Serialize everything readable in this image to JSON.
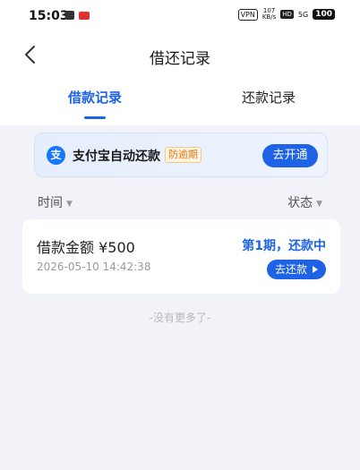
{
  "status_bar": {
    "time": "15:03",
    "vpn": "VPN",
    "net_speed_value": "107",
    "net_speed_unit": "KB/s",
    "hd": "HD",
    "signal": "5G",
    "battery": "100"
  },
  "header": {
    "title": "借还记录",
    "back_icon": "chevron-left-icon"
  },
  "tabs": [
    {
      "label": "借款记录",
      "active": true
    },
    {
      "label": "还款记录",
      "active": false
    }
  ],
  "alipay_banner": {
    "icon": "alipay-icon",
    "icon_glyph": "支",
    "text": "支付宝自动还款",
    "badge": "防逾期",
    "button_label": "去开通"
  },
  "filters": {
    "time_label": "时间",
    "status_label": "状态"
  },
  "records": [
    {
      "amount_label": "借款金额 ¥500",
      "datetime": "2026-05-10 14:42:38",
      "status": "第1期，还款中",
      "action_label": "去还款"
    }
  ],
  "footer_text": "-没有更多了-",
  "colors": {
    "accent": "#1e63e6",
    "background": "#f1f3f8",
    "badge": "#e07a12"
  }
}
